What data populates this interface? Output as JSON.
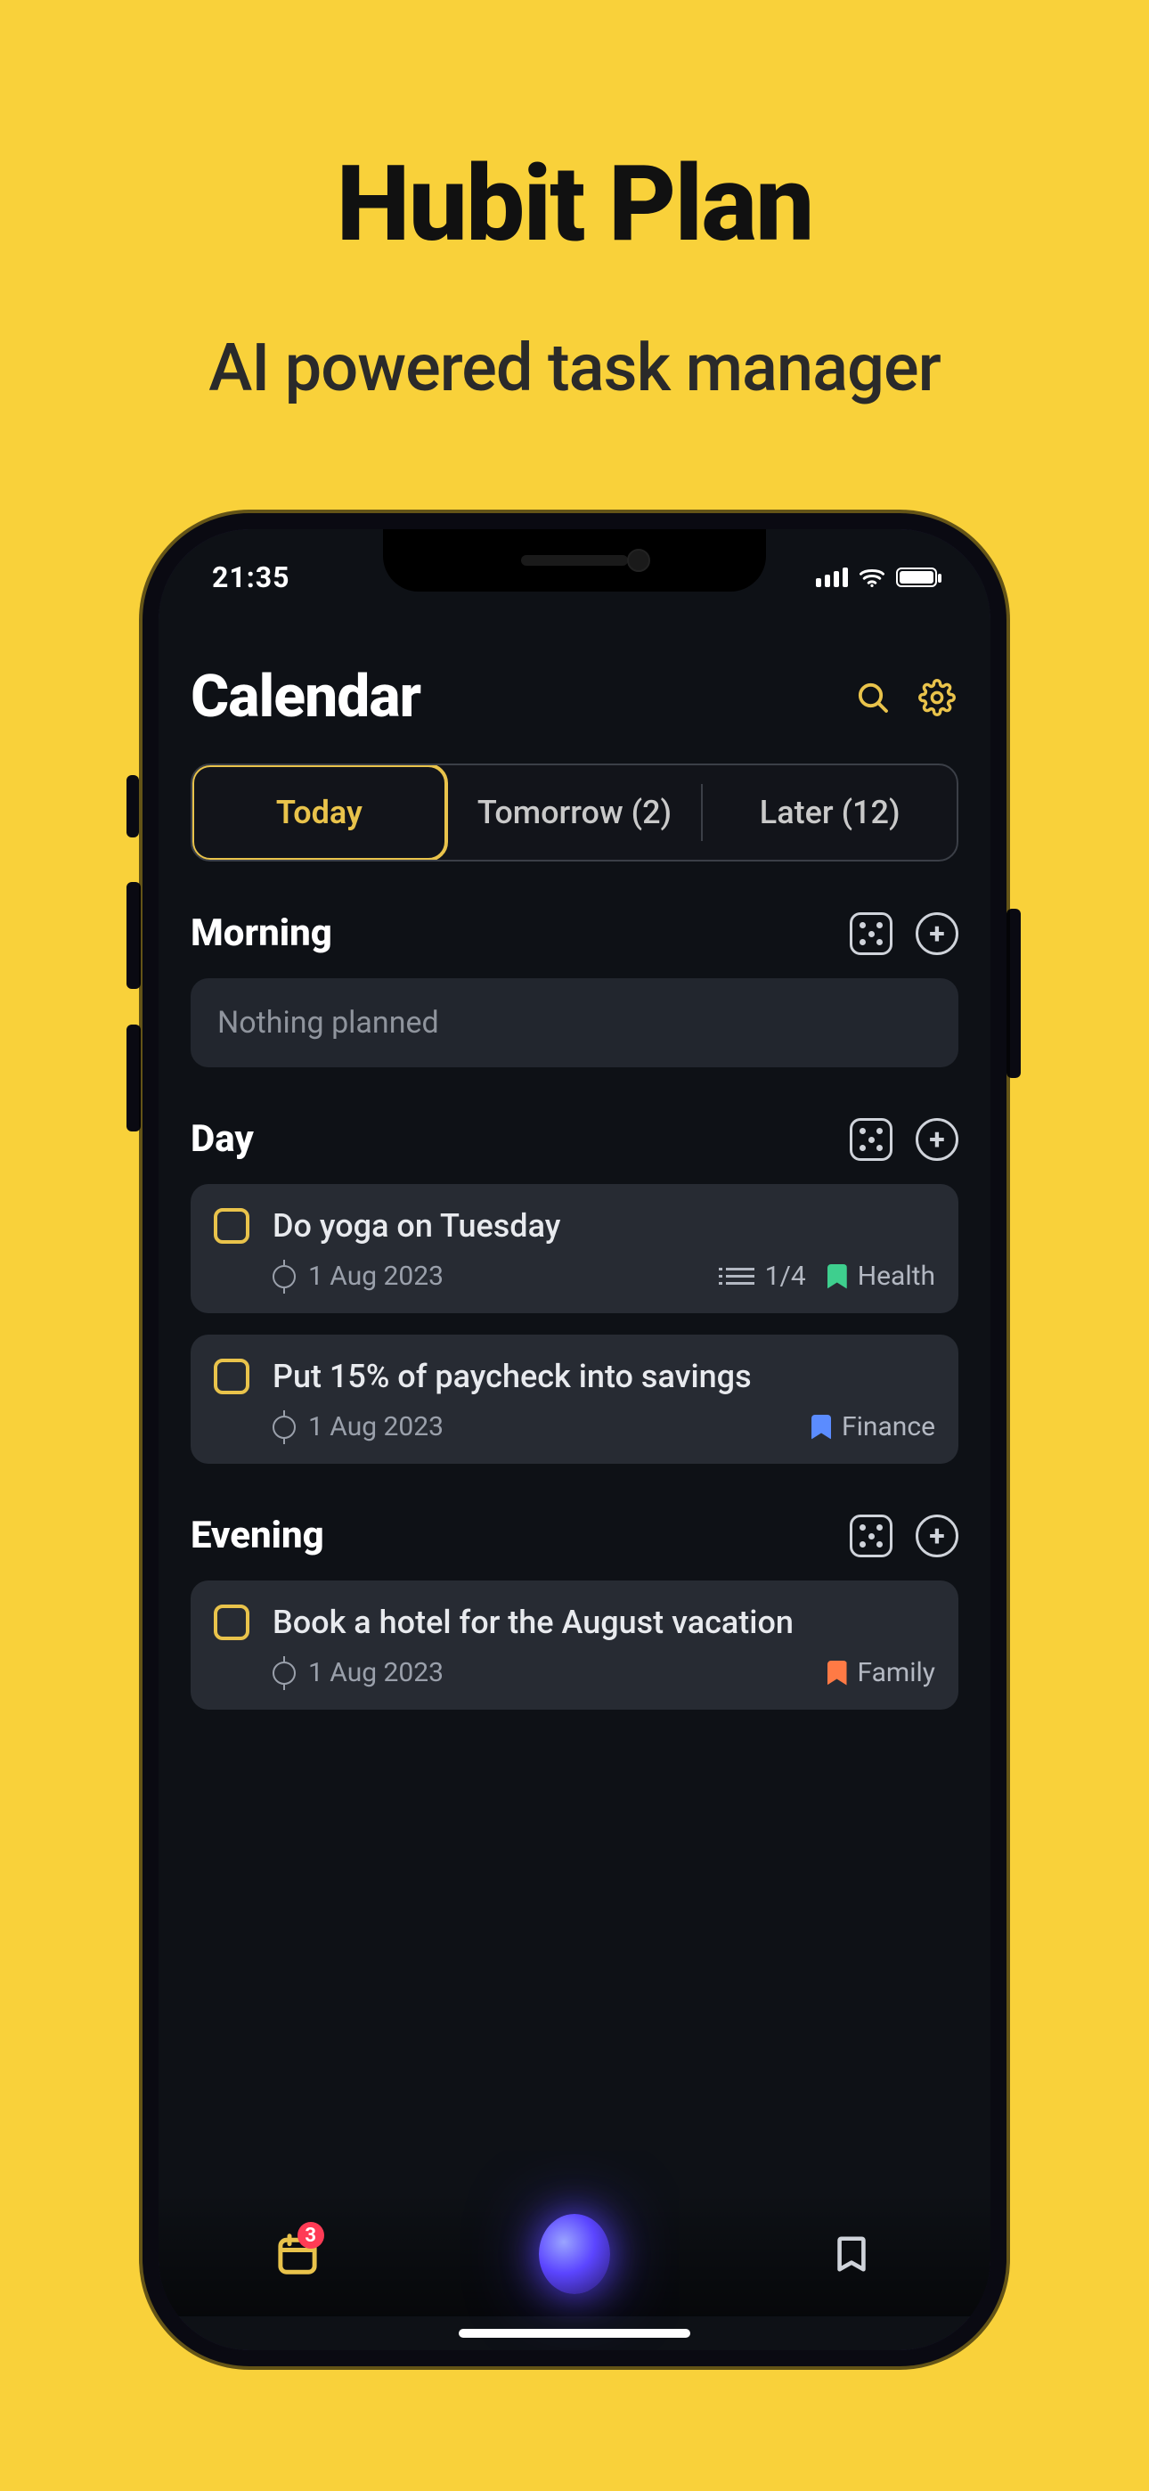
{
  "promo": {
    "title": "Hubit Plan",
    "subtitle": "AI powered task manager"
  },
  "status": {
    "time": "21:35"
  },
  "header": {
    "title": "Calendar"
  },
  "tabs": {
    "today": "Today",
    "tomorrow": "Tomorrow  (2)",
    "later": "Later (12)"
  },
  "sections": {
    "morning": {
      "title": "Morning",
      "empty": "Nothing planned"
    },
    "day": {
      "title": "Day",
      "task1": {
        "title": "Do yoga on Tuesday",
        "date": "1 Aug 2023",
        "progress": "1/4",
        "tag": "Health"
      },
      "task2": {
        "title": "Put 15% of paycheck into savings",
        "date": "1 Aug 2023",
        "tag": "Finance"
      }
    },
    "evening": {
      "title": "Evening",
      "task1": {
        "title": "Book a hotel for the August vacation",
        "date": "1 Aug 2023",
        "tag": "Family"
      }
    }
  },
  "tabbar": {
    "badge": "3"
  }
}
